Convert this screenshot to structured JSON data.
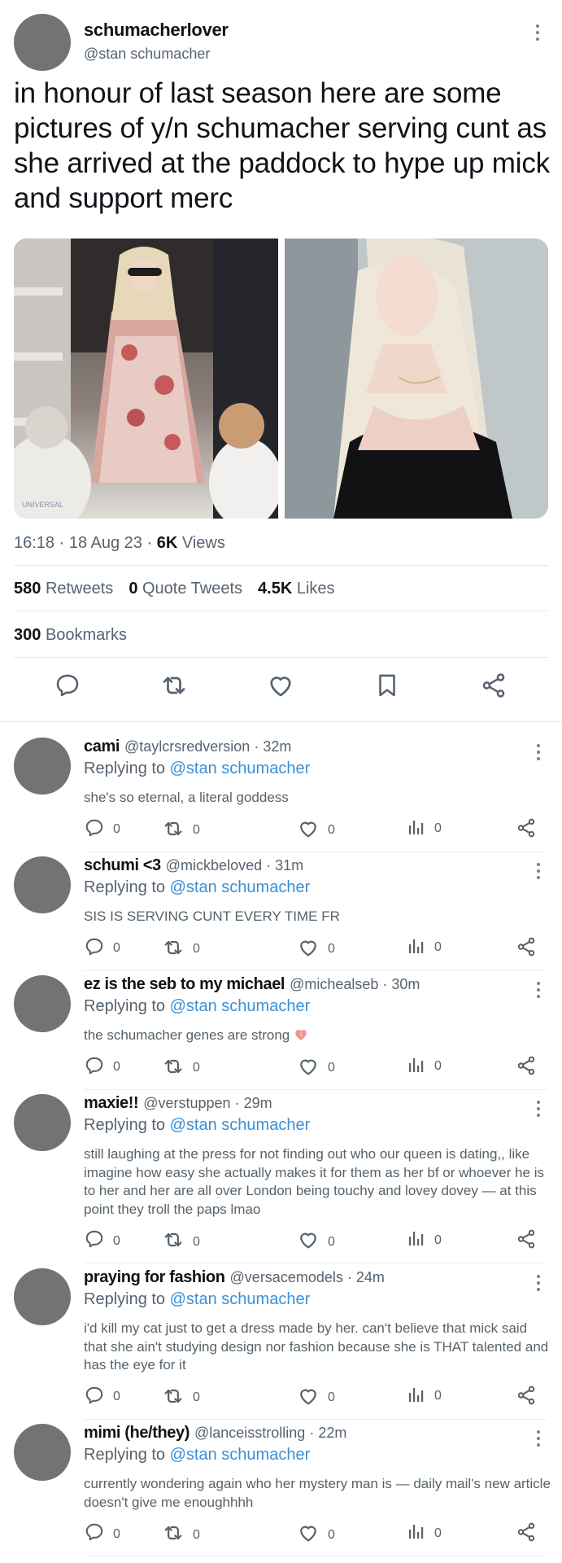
{
  "tweet": {
    "display_name": "schumacherlover",
    "handle": "@stan schumacher",
    "text": "in honour of last season here are some pictures of y/n schumacher serving cunt as she arrived at the paddock to hype up mick and support merc",
    "time": "16:18",
    "date": "18 Aug 23",
    "views_count": "6K",
    "views_label": "Views",
    "retweets_count": "580",
    "retweets_label": "Retweets",
    "quotes_count": "0",
    "quotes_label": "Quote Tweets",
    "likes_count": "4.5K",
    "likes_label": "Likes",
    "bookmarks_count": "300",
    "bookmarks_label": "Bookmarks",
    "media_watermark": "UNIVERSAL"
  },
  "replying_label": "Replying to",
  "replies": [
    {
      "name": "cami",
      "handle": "@taylcrsredversion",
      "time": "32m",
      "mention": "@stan schumacher",
      "text": "she's so eternal, a literal goddess",
      "replies": "0",
      "retweets": "0",
      "likes": "0",
      "views": "0"
    },
    {
      "name": "schumi <3",
      "handle": "@mickbeloved",
      "time": "31m",
      "mention": "@stan schumacher",
      "text": "SIS IS SERVING CUNT EVERY TIME FR",
      "replies": "0",
      "retweets": "0",
      "likes": "0",
      "views": "0"
    },
    {
      "name": "ez is the seb to my michael",
      "handle": "@michealseb",
      "time": "30m",
      "mention": "@stan schumacher",
      "text": "the schumacher genes are strong",
      "replies": "0",
      "retweets": "0",
      "likes": "0",
      "views": "0"
    },
    {
      "name": "maxie!!",
      "handle": "@verstuppen",
      "time": "29m",
      "mention": "@stan schumacher",
      "text": "still laughing at the press for not finding out who our queen is dating,, like imagine how easy she actually makes it for them as her bf or whoever he is to her and her are all over London being touchy and lovey dovey — at this point they troll the paps lmao",
      "replies": "0",
      "retweets": "0",
      "likes": "0",
      "views": "0"
    },
    {
      "name": "praying for fashion",
      "handle": "@versacemodels",
      "time": "24m",
      "mention": "@stan schumacher",
      "text": "i'd kill my cat just to get a dress made by her. can't believe that mick said that she ain't studying design nor fashion because she is THAT talented and has the eye for it",
      "replies": "0",
      "retweets": "0",
      "likes": "0",
      "views": "0"
    },
    {
      "name": "mimi (he/they)",
      "handle": "@lanceisstrolling",
      "time": "22m",
      "mention": "@stan schumacher",
      "text": "currently wondering again who her mystery man is — daily mail's new article doesn't give me enoughhhh",
      "replies": "0",
      "retweets": "0",
      "likes": "0",
      "views": "0"
    }
  ],
  "colors": {
    "accent_link": "#3a8fd6",
    "secondary_text": "#566370",
    "avatar_placeholder": "#737373"
  },
  "icons": [
    "more-icon",
    "reply-icon",
    "retweet-icon",
    "like-icon",
    "bookmark-icon",
    "share-icon",
    "views-icon",
    "heart-emoji-icon"
  ]
}
